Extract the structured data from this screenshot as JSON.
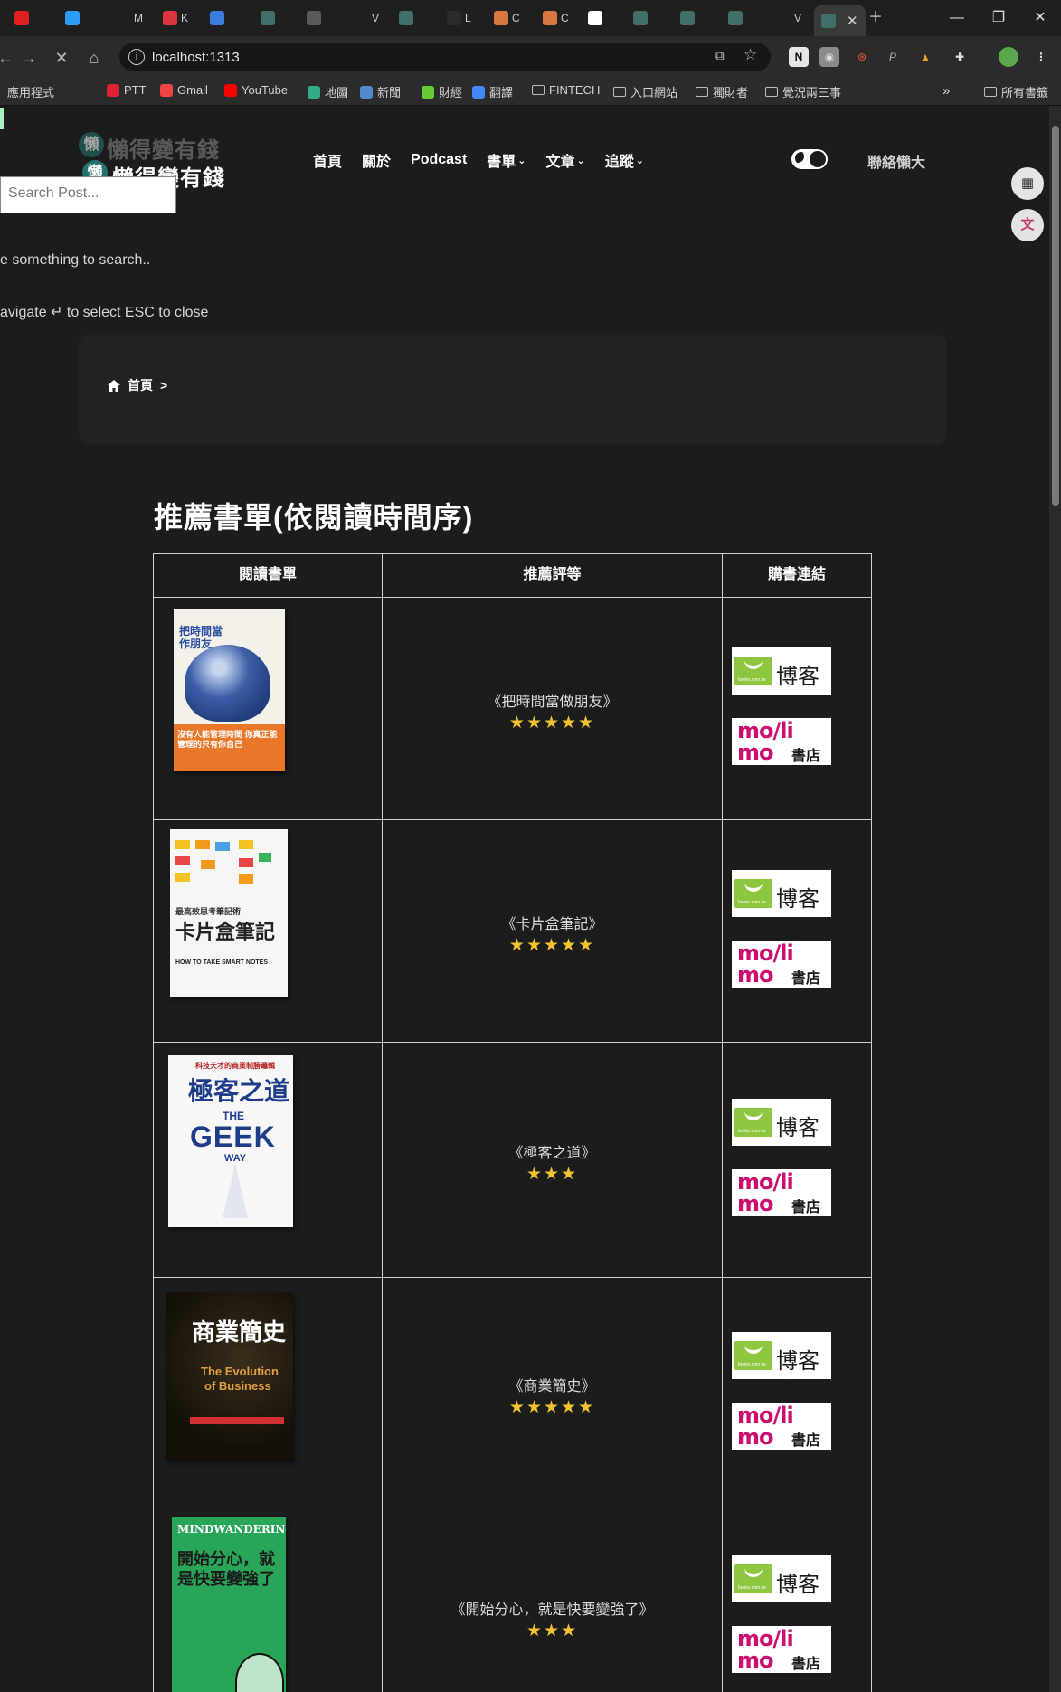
{
  "browser": {
    "tabs": [
      {
        "label": "",
        "color": "#e02020"
      },
      {
        "label": "",
        "color": "#2a9df4"
      },
      {
        "label": "M",
        "color": "#1f1f1f"
      },
      {
        "label": "K",
        "color": "#d9363e"
      },
      {
        "label": "",
        "color": "#3b7ddd"
      },
      {
        "label": "",
        "color": "#3f6f68"
      },
      {
        "label": "",
        "color": "#5a5a5a"
      },
      {
        "label": "V",
        "color": "#1f1f1f"
      },
      {
        "label": "",
        "color": "#3f6f68"
      },
      {
        "label": "L",
        "color": "#2a2a2a"
      },
      {
        "label": "C",
        "color": "#d97744"
      },
      {
        "label": "C",
        "color": "#d97744"
      },
      {
        "label": "",
        "color": "#ffffff"
      },
      {
        "label": "",
        "color": "#3f6f68"
      },
      {
        "label": "",
        "color": "#3f6f68"
      },
      {
        "label": "",
        "color": "#3f6f68"
      },
      {
        "label": "V",
        "color": "#1f1f1f"
      }
    ],
    "url": "localhost:1313",
    "bookmarks": [
      {
        "label": "應用程式"
      },
      {
        "label": "PTT"
      },
      {
        "label": "Gmail"
      },
      {
        "label": "YouTube"
      },
      {
        "label": "地圖"
      },
      {
        "label": "新聞"
      },
      {
        "label": "財經"
      },
      {
        "label": "翻譯"
      },
      {
        "label": "FINTECH"
      },
      {
        "label": "入口網站"
      },
      {
        "label": "獨財者"
      },
      {
        "label": "覺況兩三事"
      }
    ],
    "bookmarks_overflow": "»",
    "all_bookmarks": "所有書籤"
  },
  "site": {
    "logo_char": "懶",
    "logo_text": "懶得變有錢",
    "nav": [
      {
        "label": "首頁",
        "dropdown": false
      },
      {
        "label": "關於",
        "dropdown": false
      },
      {
        "label": "Podcast",
        "dropdown": false
      },
      {
        "label": "書單",
        "dropdown": true
      },
      {
        "label": "文章",
        "dropdown": true
      },
      {
        "label": "追蹤",
        "dropdown": true
      }
    ],
    "contact": "聯絡懶大",
    "search": {
      "placeholder": "Search Post...",
      "hint_type": "e something to search..",
      "hint_keys": "avigate ↵  to select ESC to close"
    },
    "breadcrumb": {
      "home": "首頁",
      "sep": ">"
    }
  },
  "main": {
    "title": "推薦書單(依閱讀時間序)",
    "table": {
      "headers": [
        "閱讀書單",
        "推薦評等",
        "購書連結"
      ],
      "shop_labels": {
        "books": "博客來",
        "momo": "書店"
      },
      "rows": [
        {
          "name": "《把時間當做朋友》",
          "rating": 5
        },
        {
          "name": "《卡片盒筆記》",
          "rating": 5
        },
        {
          "name": "《極客之道》",
          "rating": 3
        },
        {
          "name": "《商業簡史》",
          "rating": 5
        },
        {
          "name": "《開始分心，就是快要變強了》",
          "rating": 3
        }
      ]
    }
  },
  "covers": [
    {
      "title": "把時間當作朋友",
      "tagline": "沒有人能管理時間 你真正能管理的只有你自己"
    },
    {
      "title": "卡片盒筆記",
      "subtitle": "最高效思考筆記術",
      "en": "HOW TO TAKE SMART NOTES"
    },
    {
      "title": "極客之道",
      "top": "科技天才的商業制勝邏輯",
      "en1": "THE",
      "en2": "GEEK",
      "en3": "WAY"
    },
    {
      "title": "商業簡史",
      "en1": "The Evolution",
      "en2": "of Business"
    },
    {
      "title": "開始分心，就是快要變強了",
      "en": "MINDWANDERING"
    }
  ]
}
